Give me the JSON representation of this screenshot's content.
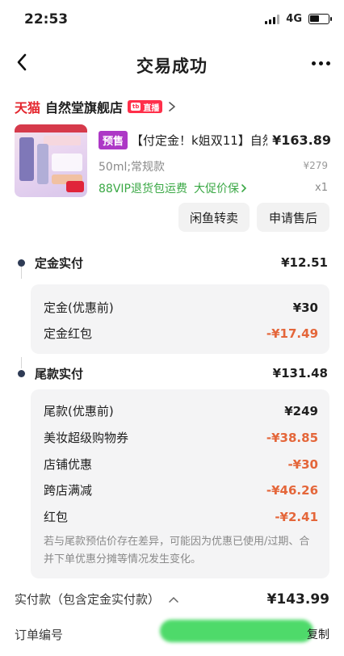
{
  "status_bar": {
    "time": "22:53",
    "network": "4G",
    "battery_level": 0.5
  },
  "nav": {
    "title": "交易成功"
  },
  "shop": {
    "platform": "天猫",
    "name": "自然堂旗舰店",
    "live_badge": "直播",
    "live_badge_prefix": "tb"
  },
  "product": {
    "presale_badge": "预售",
    "title": "【付定金！k姐双11】自然",
    "price": "¥163.89",
    "spec": "50ml;常规款",
    "original_price": "¥279",
    "service_1": "88VIP退货包运费",
    "service_2": "大促价保",
    "quantity": "x1"
  },
  "actions": {
    "resell": "闲鱼转卖",
    "after_sale": "申请售后"
  },
  "deposit": {
    "label": "定金实付",
    "amount": "¥12.51",
    "rows": [
      {
        "label": "定金(优惠前)",
        "value": "¥30"
      },
      {
        "label": "定金红包",
        "value": "-¥17.49"
      }
    ]
  },
  "balance": {
    "label": "尾款实付",
    "amount": "¥131.48",
    "rows": [
      {
        "label": "尾款(优惠前)",
        "value": "¥249"
      },
      {
        "label": "美妆超级购物券",
        "value": "-¥38.85"
      },
      {
        "label": "店铺优惠",
        "value": "-¥30"
      },
      {
        "label": "跨店满减",
        "value": "-¥46.26"
      },
      {
        "label": "红包",
        "value": "-¥2.41"
      }
    ],
    "note": "若与尾款预估价存在差异，可能因为优惠已使用/过期、合并下单优惠分摊等情况发生变化。"
  },
  "total": {
    "label": "实付款（包含定金实付款）",
    "amount": "¥143.99"
  },
  "order": {
    "label": "订单编号",
    "copy": "复制"
  },
  "colors": {
    "tmall_red": "#e4252d",
    "presale_purple": "#ad38c6",
    "service_green": "#3aa845",
    "discount_orange": "#e4663a",
    "redaction_green": "#3bd65a"
  }
}
